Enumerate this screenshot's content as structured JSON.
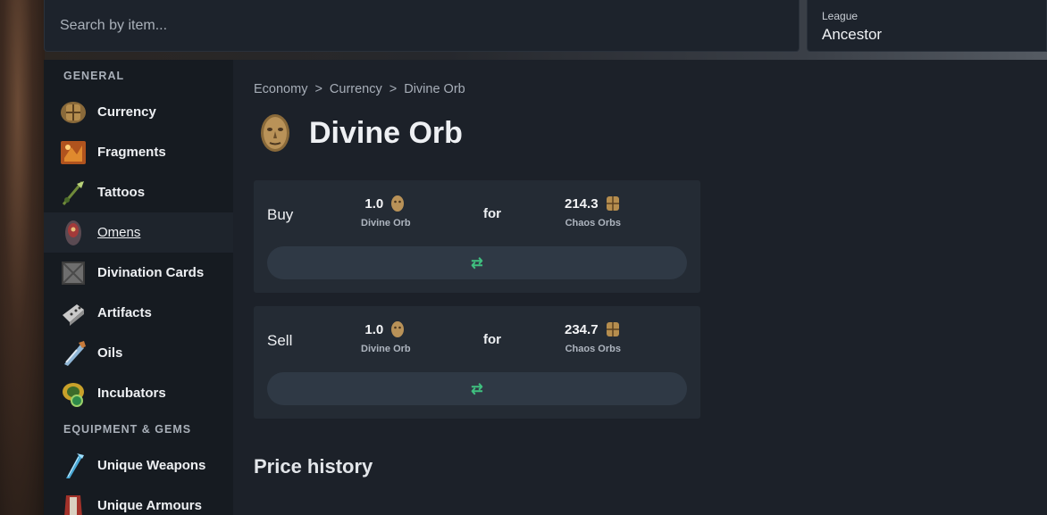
{
  "search": {
    "placeholder": "Search by item..."
  },
  "league": {
    "label": "League",
    "value": "Ancestor"
  },
  "sidebar": {
    "general_title": "GENERAL",
    "general_items": [
      {
        "label": "Currency",
        "icon": "currency-icon"
      },
      {
        "label": "Fragments",
        "icon": "fragments-icon"
      },
      {
        "label": "Tattoos",
        "icon": "tattoos-icon"
      },
      {
        "label": "Omens",
        "icon": "omens-icon",
        "active": true
      },
      {
        "label": "Divination Cards",
        "icon": "divination-cards-icon"
      },
      {
        "label": "Artifacts",
        "icon": "artifacts-icon"
      },
      {
        "label": "Oils",
        "icon": "oils-icon"
      },
      {
        "label": "Incubators",
        "icon": "incubators-icon"
      }
    ],
    "equipment_title": "EQUIPMENT & GEMS",
    "equipment_items": [
      {
        "label": "Unique Weapons",
        "icon": "unique-weapons-icon"
      },
      {
        "label": "Unique Armours",
        "icon": "unique-armours-icon"
      }
    ]
  },
  "breadcrumb": {
    "items": [
      "Economy",
      "Currency",
      "Divine Orb"
    ],
    "separator": ">"
  },
  "item": {
    "title": "Divine Orb"
  },
  "buy": {
    "label": "Buy",
    "give_amount": "1.0",
    "give_name": "Divine Orb",
    "for_label": "for",
    "get_amount": "214.3",
    "get_name": "Chaos Orbs",
    "swap_glyph": "⇄"
  },
  "sell": {
    "label": "Sell",
    "give_amount": "1.0",
    "give_name": "Divine Orb",
    "for_label": "for",
    "get_amount": "234.7",
    "get_name": "Chaos Orbs",
    "swap_glyph": "⇄"
  },
  "price_history": {
    "title": "Price history"
  },
  "colors": {
    "accent_green": "#3fbf7f",
    "panel": "#242b34",
    "sidebar": "#161b21"
  }
}
